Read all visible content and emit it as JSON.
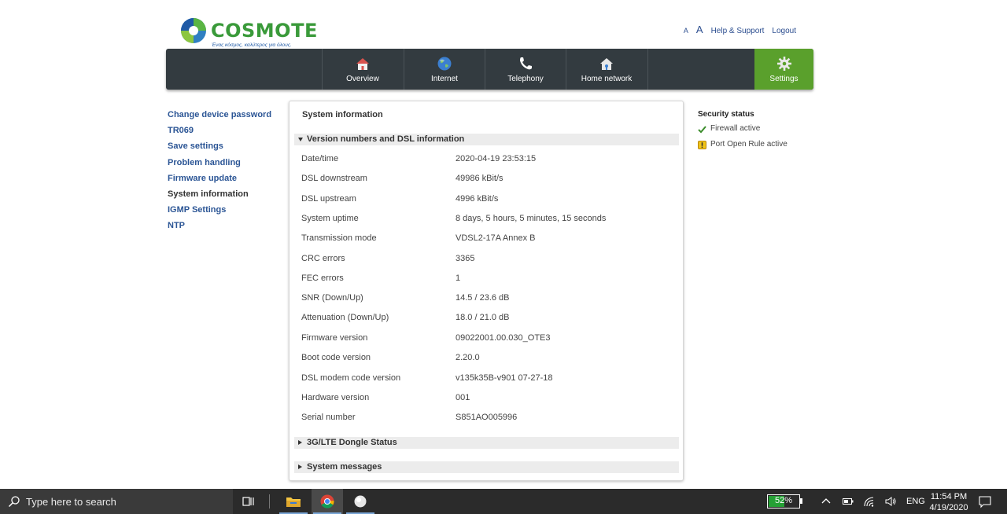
{
  "header": {
    "logo_text": "COSMOTE",
    "logo_tagline": "Ένας κόσμος, καλύτερος για όλους.",
    "font_small": "A",
    "font_large": "A",
    "help_link": "Help & Support",
    "logout_link": "Logout"
  },
  "nav": {
    "items": [
      {
        "label": "Overview",
        "icon": "home-icon"
      },
      {
        "label": "Internet",
        "icon": "globe-icon"
      },
      {
        "label": "Telephony",
        "icon": "phone-icon"
      },
      {
        "label": "Home network",
        "icon": "home-network-icon"
      }
    ],
    "settings": {
      "label": "Settings",
      "icon": "gear-icon"
    }
  },
  "left_menu": {
    "items": [
      "Change device password",
      "TR069",
      "Save settings",
      "Problem handling",
      "Firmware update",
      "System information",
      "IGMP Settings",
      "NTP"
    ],
    "active": "System information"
  },
  "panel": {
    "title": "System information",
    "section_version": "Version numbers and DSL information",
    "rows": [
      {
        "label": "Date/time",
        "value": "2020-04-19 23:53:15"
      },
      {
        "label": "DSL downstream",
        "value": "49986 kBit/s"
      },
      {
        "label": "DSL upstream",
        "value": "4996 kBit/s"
      },
      {
        "label": "System uptime",
        "value": "8 days, 5 hours, 5 minutes, 15 seconds"
      },
      {
        "label": "Transmission mode",
        "value": "VDSL2-17A Annex B"
      },
      {
        "label": "CRC errors",
        "value": "3365"
      },
      {
        "label": "FEC errors",
        "value": "1"
      },
      {
        "label": "SNR (Down/Up)",
        "value": "14.5 / 23.6 dB"
      },
      {
        "label": "Attenuation (Down/Up)",
        "value": "18.0 / 21.0 dB"
      },
      {
        "label": "Firmware version",
        "value": "09022001.00.030_OTE3"
      },
      {
        "label": "Boot code version",
        "value": "2.20.0"
      },
      {
        "label": "DSL modem code version",
        "value": "v135k35B-v901 07-27-18"
      },
      {
        "label": "Hardware version",
        "value": "001"
      },
      {
        "label": "Serial number",
        "value": "S851AO005996"
      }
    ],
    "section_lte": "3G/LTE Dongle Status",
    "section_messages": "System messages"
  },
  "security": {
    "title": "Security status",
    "items": [
      {
        "label": "Firewall active",
        "icon": "check-icon"
      },
      {
        "label": "Port Open Rule active",
        "icon": "warning-icon"
      }
    ]
  },
  "taskbar": {
    "search_placeholder": "Type here to search",
    "battery_percent": "52%",
    "battery_level": 0.52,
    "language": "ENG",
    "time": "11:54 PM",
    "date": "4/19/2020"
  },
  "colors": {
    "nav_bg": "#333b40",
    "settings_green": "#5aa02c",
    "link_blue": "#2b5595",
    "brand_green": "#3a9a3a"
  }
}
